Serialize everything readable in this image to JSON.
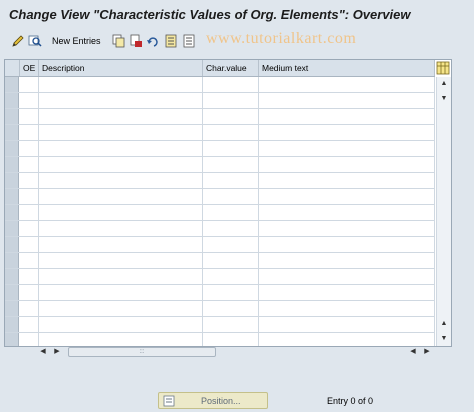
{
  "window": {
    "title": "Change View \"Characteristic Values of Org. Elements\": Overview"
  },
  "toolbar": {
    "new_entries_label": "New Entries",
    "watermark": "www.tutorialkart.com",
    "icons": [
      "edit-icon",
      "find-icon",
      "copy-icon",
      "delete-icon",
      "undo-icon",
      "select-all-icon",
      "deselect-all-icon"
    ]
  },
  "table": {
    "columns": [
      "OE",
      "Description",
      "Char.value",
      "Medium text"
    ],
    "row_count": 17
  },
  "footer": {
    "position_label": "Position...",
    "entry_info": "Entry 0 of 0"
  },
  "colors": {
    "background": "#dfe6ed",
    "header": "#d8e1ea",
    "position_button": "#ece9c9",
    "watermark": "#f0c48a"
  }
}
